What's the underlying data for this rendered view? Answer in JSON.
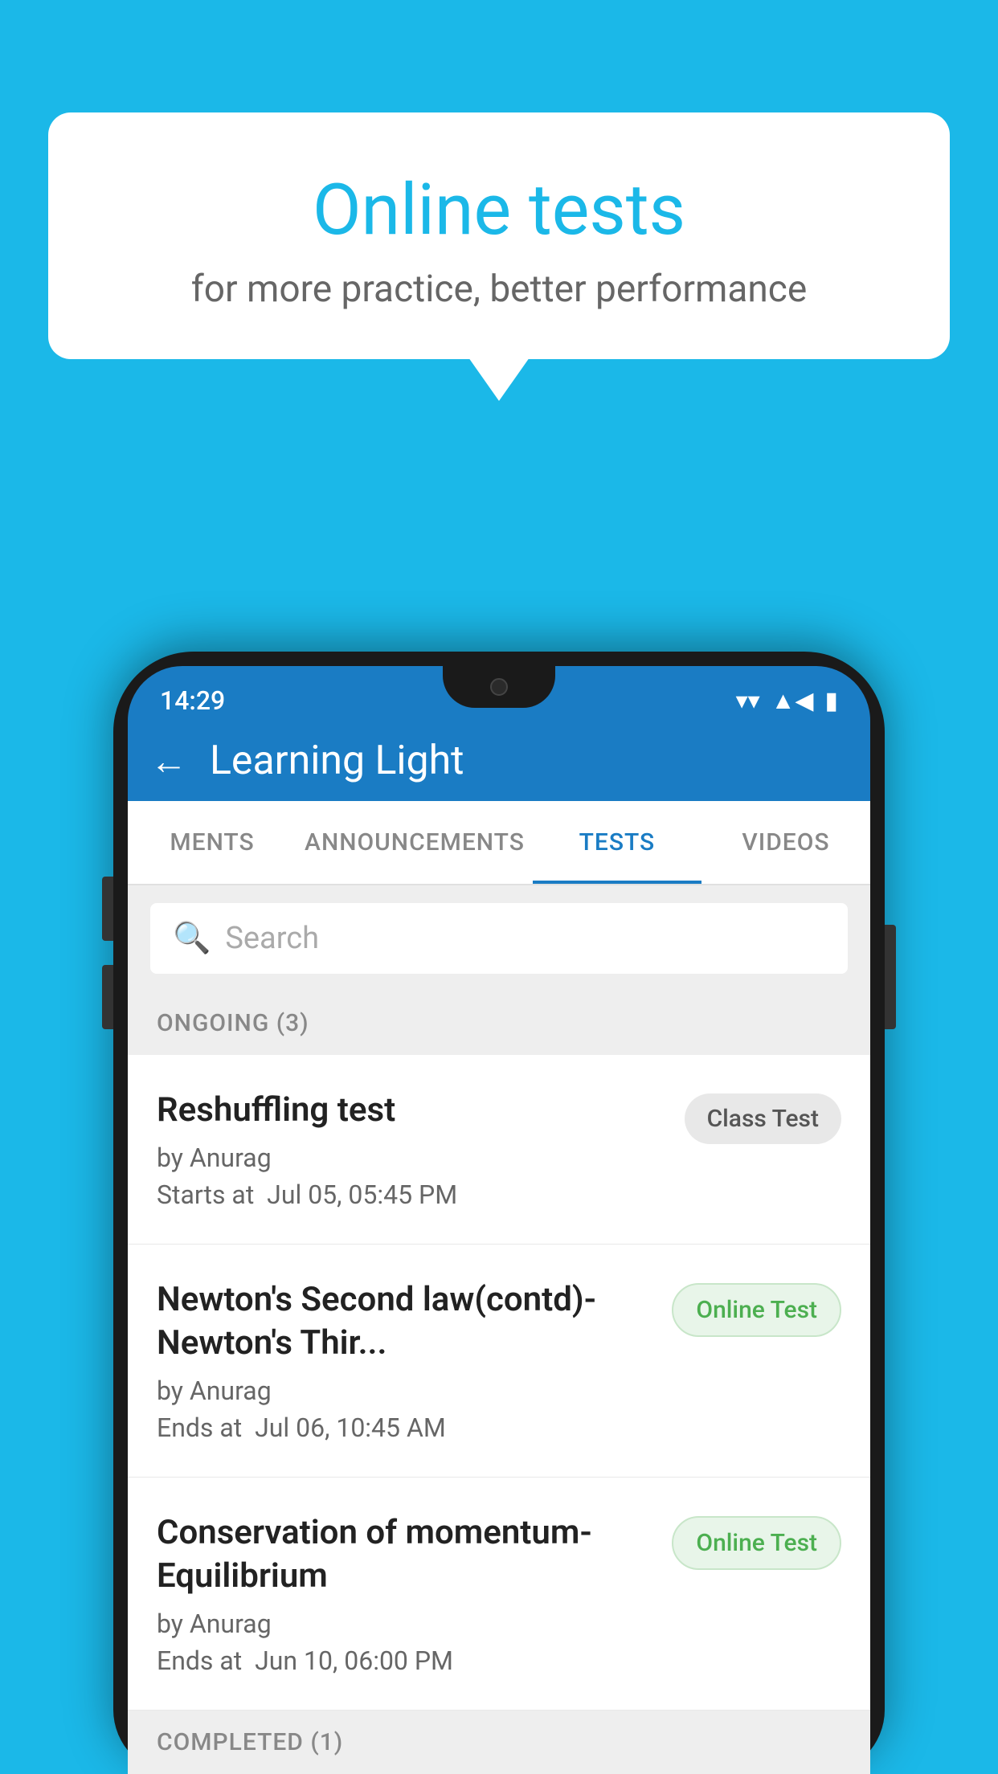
{
  "background_color": "#1bb8e8",
  "bubble": {
    "title": "Online tests",
    "subtitle": "for more practice, better performance"
  },
  "phone": {
    "status_bar": {
      "time": "14:29",
      "wifi_icon": "▼",
      "signal_icon": "◀",
      "battery_icon": "▮"
    },
    "header": {
      "title": "Learning Light",
      "back_label": "←"
    },
    "tabs": [
      {
        "label": "MENTS",
        "active": false
      },
      {
        "label": "ANNOUNCEMENTS",
        "active": false
      },
      {
        "label": "TESTS",
        "active": true
      },
      {
        "label": "VIDEOS",
        "active": false
      }
    ],
    "search": {
      "placeholder": "Search"
    },
    "ongoing_section": {
      "label": "ONGOING (3)"
    },
    "tests": [
      {
        "name": "Reshuffling test",
        "author": "by Anurag",
        "time_label": "Starts at",
        "time_value": "Jul 05, 05:45 PM",
        "badge": "Class Test",
        "badge_type": "class"
      },
      {
        "name": "Newton's Second law(contd)-Newton's Thir...",
        "author": "by Anurag",
        "time_label": "Ends at",
        "time_value": "Jul 06, 10:45 AM",
        "badge": "Online Test",
        "badge_type": "online"
      },
      {
        "name": "Conservation of momentum-Equilibrium",
        "author": "by Anurag",
        "time_label": "Ends at",
        "time_value": "Jun 10, 06:00 PM",
        "badge": "Online Test",
        "badge_type": "online"
      }
    ],
    "completed_section": {
      "label": "COMPLETED (1)"
    }
  }
}
